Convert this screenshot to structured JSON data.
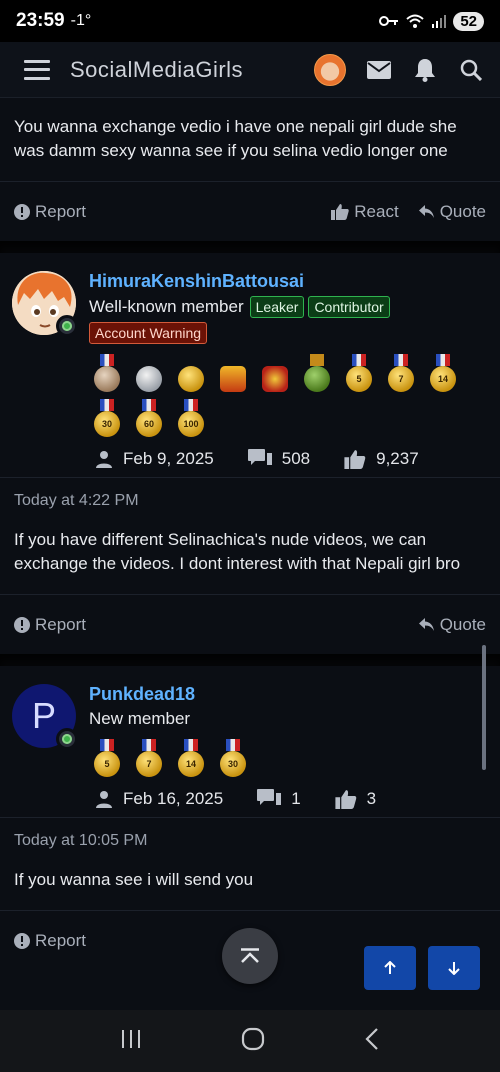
{
  "status": {
    "time": "23:59",
    "temp": "-1°",
    "battery": "52"
  },
  "app": {
    "title": "SocialMediaGirls"
  },
  "previous_post": {
    "text": "You wanna exchange vedio i have one nepali girl dude she was damm sexy wanna see if you selina vedio longer one"
  },
  "actions": {
    "report": "Report",
    "react": "React",
    "quote": "Quote"
  },
  "posts": [
    {
      "username": "HimuraKenshinBattousai",
      "user_title": "Well-known member",
      "badges": [
        "Leaker",
        "Contributor"
      ],
      "warning_badge": "Account Warning",
      "trophies": [
        "",
        "",
        "",
        "",
        "",
        "",
        "5",
        "7",
        "14",
        "30",
        "60",
        "100"
      ],
      "joined": "Feb 9, 2025",
      "messages": "508",
      "reactions": "9,237",
      "time": "Today at 4:22 PM",
      "text": "If you have different Selinachica's nude videos, we can exchange the videos. I dont interest with that Nepali girl bro"
    },
    {
      "username": "Punkdead18",
      "avatar_letter": "P",
      "user_title": "New member",
      "trophies": [
        "5",
        "7",
        "14",
        "30"
      ],
      "joined": "Feb 16, 2025",
      "messages": "1",
      "reactions": "3",
      "time": "Today at 10:05 PM",
      "text": "If you wanna see i will send you"
    }
  ]
}
